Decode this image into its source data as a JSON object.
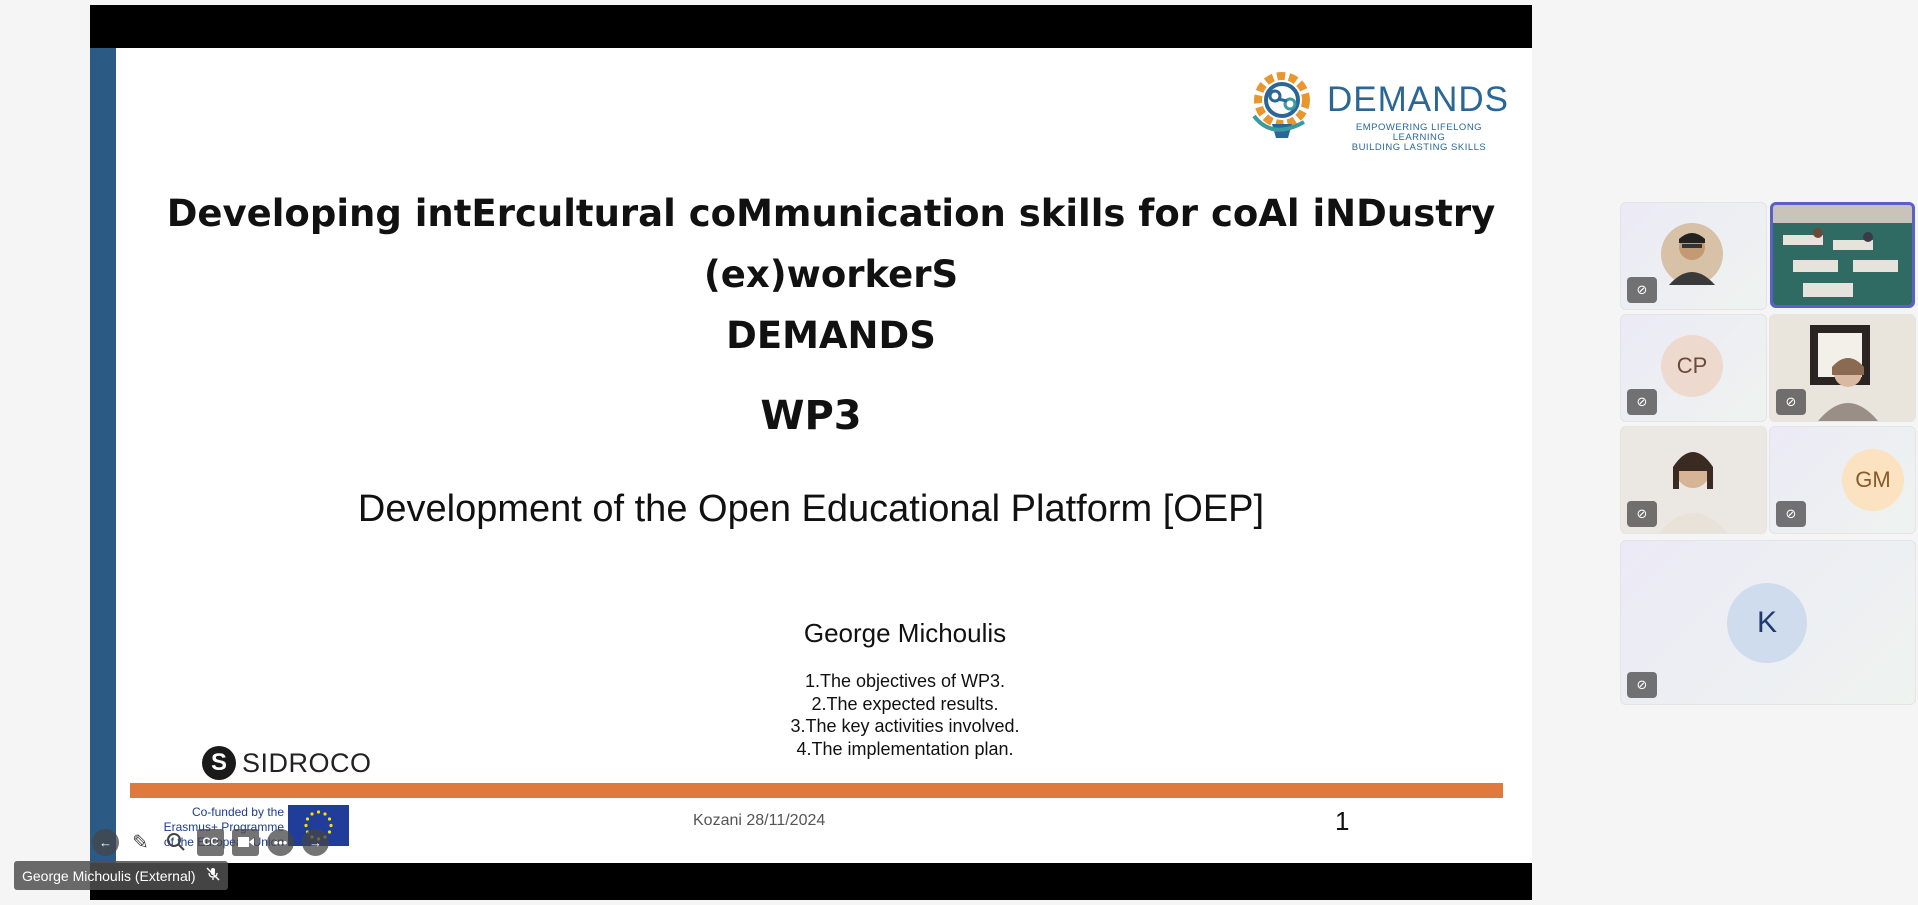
{
  "slide": {
    "title_line1": "Developing intErcultural coMmunication skills for coAl iNDustry (ex)workerS",
    "title_line2": "DEMANDS",
    "workpackage": "WP3",
    "subtitle": "Development of the Open Educational Platform [OEP]",
    "author": "George Michoulis",
    "outline": [
      "1.The objectives of WP3.",
      "2.The expected results.",
      "3.The key activities involved.",
      "4.The implementation plan."
    ],
    "logo_word": "DEMANDS",
    "logo_tagline_1": "EMPOWERING LIFELONG LEARNING",
    "logo_tagline_2": "BUILDING LASTING SKILLS",
    "sidroco_logo": "SIDROCO",
    "eu_text": [
      "Co-funded by the",
      "Erasmus+ Programme",
      "of the European Union"
    ],
    "footer_date": "Kozani 28/11/2024",
    "page_number": "1",
    "colors": {
      "left_bar": "#2b5a84",
      "orange_bar": "#e07a3c",
      "brand_blue": "#2a6796"
    }
  },
  "toolbar": {
    "icons": [
      "back-icon",
      "pen-icon",
      "search-icon",
      "captions-icon",
      "camera-icon",
      "more-icon",
      "forward-icon"
    ],
    "captions_label": "CC"
  },
  "presenter": {
    "name": "George Michoulis (External)"
  },
  "participants": [
    {
      "type": "avatar-photo",
      "initials": ""
    },
    {
      "type": "video",
      "active": true
    },
    {
      "type": "initials",
      "initials": "CP"
    },
    {
      "type": "video"
    },
    {
      "type": "video"
    },
    {
      "type": "initials",
      "initials": "GM"
    },
    {
      "type": "initials",
      "initials": "K"
    }
  ]
}
